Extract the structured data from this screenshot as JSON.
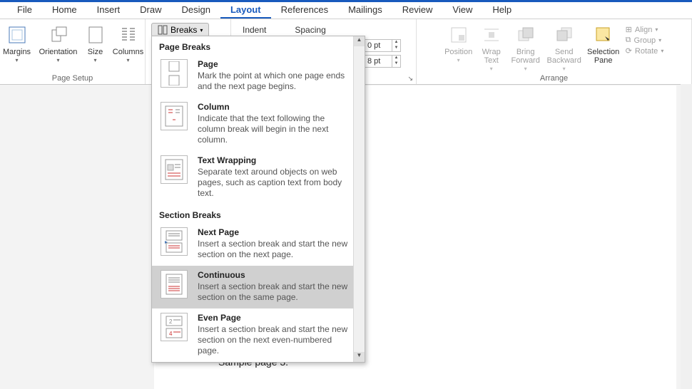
{
  "tabs": {
    "items": [
      "File",
      "Home",
      "Insert",
      "Draw",
      "Design",
      "Layout",
      "References",
      "Mailings",
      "Review",
      "View",
      "Help"
    ],
    "active": "Layout"
  },
  "page_setup": {
    "margins": "Margins",
    "orientation": "Orientation",
    "size": "Size",
    "columns": "Columns",
    "group_label": "Page Setup"
  },
  "breaks_button": "Breaks",
  "paragraph": {
    "indent_label": "Indent",
    "spacing_label": "Spacing",
    "val1": "0 pt",
    "val2": "8 pt"
  },
  "arrange": {
    "position": "Position",
    "wrap_text": "Wrap Text",
    "bring_forward": "Bring Forward",
    "send_backward": "Send Backward",
    "selection_pane": "Selection Pane",
    "align": "Align",
    "group": "Group",
    "rotate": "Rotate",
    "group_label": "Arrange"
  },
  "dropdown": {
    "header1": "Page Breaks",
    "header2": "Section Breaks",
    "items": [
      {
        "title": "Page",
        "desc": "Mark the point at which one page ends and the next page begins."
      },
      {
        "title": "Column",
        "desc": "Indicate that the text following the column break will begin in the next column."
      },
      {
        "title": "Text Wrapping",
        "desc": "Separate text around objects on web pages, such as caption text from body text."
      },
      {
        "title": "Next Page",
        "desc": "Insert a section break and start the new section on the next page."
      },
      {
        "title": "Continuous",
        "desc": "Insert a section break and start the new section on the same page."
      },
      {
        "title": "Even Page",
        "desc": "Insert a section break and start the new section on the next even-numbered page."
      }
    ]
  },
  "document": {
    "sample_text": "Sample page 3."
  }
}
